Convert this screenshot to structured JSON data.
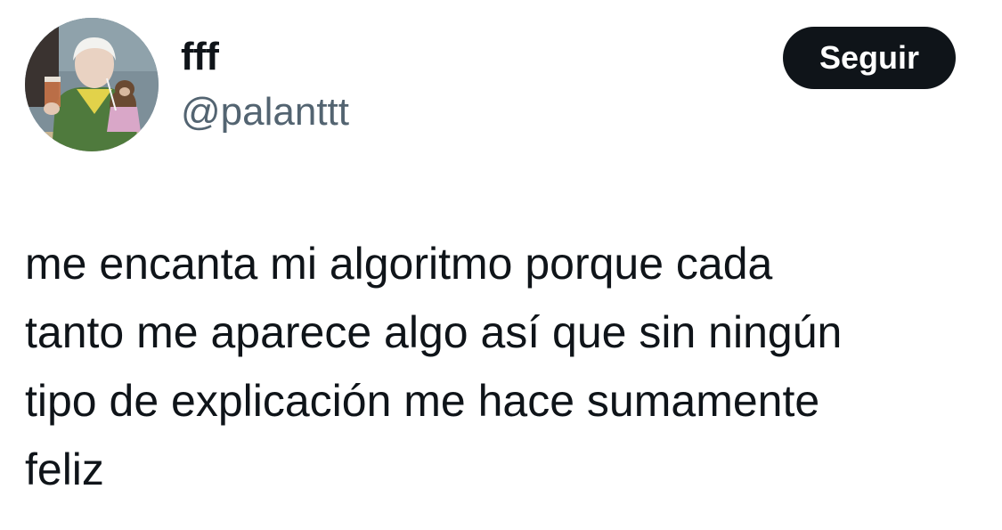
{
  "author": {
    "display_name": "fff",
    "handle": "@palanttt",
    "avatar_icon": "profile-photo-avatar"
  },
  "follow_button": {
    "label": "Seguir"
  },
  "tweet": {
    "text": "me encanta mi algoritmo porque cada\ntanto me aparece algo así que sin ningún\ntipo de explicación me hace sumamente\nfeliz"
  },
  "colors": {
    "text": "#0f1419",
    "secondary_text": "#536471",
    "button_bg": "#0f1419",
    "button_text": "#ffffff",
    "background": "#ffffff"
  }
}
